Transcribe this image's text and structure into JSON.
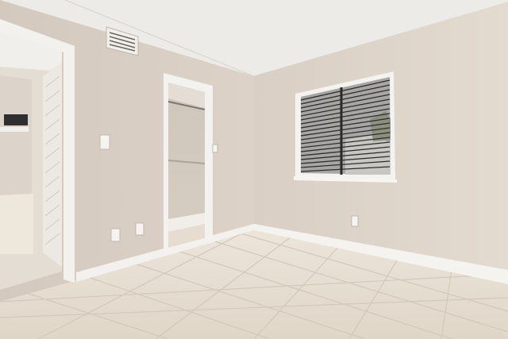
{
  "scene": {
    "kind": "photo",
    "room": "empty bedroom",
    "colors": {
      "ceiling": "#ecebe8",
      "wall_left": "#d6ccc1",
      "wall_back": "#ddd3c8",
      "floor": "#e7dfd3",
      "grout": "#cfc4b6",
      "trim": "#f4f2ee",
      "window_glass": "#a9a8a4",
      "blind": "#3d3d3d"
    },
    "visible_objects": [
      "air-vent-grille",
      "bifold-closet-door",
      "walk-in-closet",
      "window-with-blinds",
      "light-switch",
      "outlets",
      "tile-floor",
      "baseboards"
    ]
  }
}
